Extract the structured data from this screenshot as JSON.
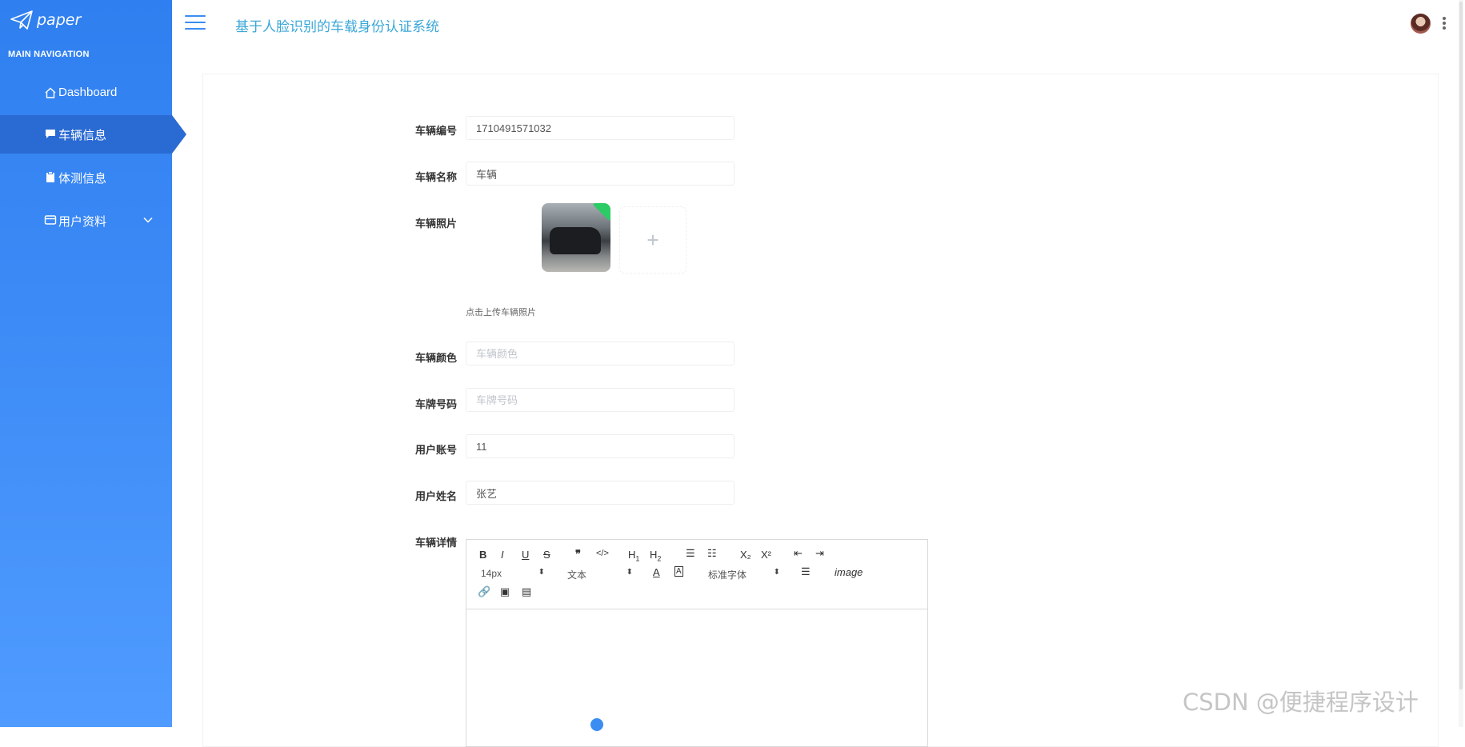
{
  "app": {
    "logo_text": "paper",
    "title": "基于人脸识别的车载身份认证系统"
  },
  "sidebar": {
    "section_title": "MAIN NAVIGATION",
    "items": [
      {
        "label": "Dashboard",
        "icon": "home-icon"
      },
      {
        "label": "车辆信息",
        "icon": "message-icon",
        "active": true
      },
      {
        "label": "体测信息",
        "icon": "clipboard-icon"
      },
      {
        "label": "用户资料",
        "icon": "card-icon",
        "has_submenu": true
      }
    ]
  },
  "form": {
    "vehicle_no": {
      "label": "车辆编号",
      "value": "1710491571032"
    },
    "vehicle_name": {
      "label": "车辆名称",
      "value": "车辆"
    },
    "vehicle_photo": {
      "label": "车辆照片",
      "upload_hint": "点击上传车辆照片"
    },
    "vehicle_color": {
      "label": "车辆颜色",
      "placeholder": "车辆颜色"
    },
    "plate_no": {
      "label": "车牌号码",
      "placeholder": "车牌号码"
    },
    "user_account": {
      "label": "用户账号",
      "value": "11"
    },
    "user_name": {
      "label": "用户姓名",
      "value": "张艺"
    },
    "vehicle_detail": {
      "label": "车辆详情"
    }
  },
  "editor": {
    "font_size": "14px",
    "text_type": "文本",
    "font_family": "标准字体",
    "buttons": [
      "B",
      "I",
      "U",
      "S",
      "99",
      "</>",
      "H1",
      "H2",
      "ordered-list",
      "bullet-list",
      "X₂",
      "X²",
      "outdent",
      "indent",
      "A",
      "A-bg",
      "align",
      "Tx",
      "link",
      "image",
      "video"
    ]
  },
  "watermark": "CSDN @便捷程序设计",
  "colors": {
    "sidebar": "#3d8bf6",
    "active": "#2a6ad3",
    "title": "#3aa7d8"
  }
}
